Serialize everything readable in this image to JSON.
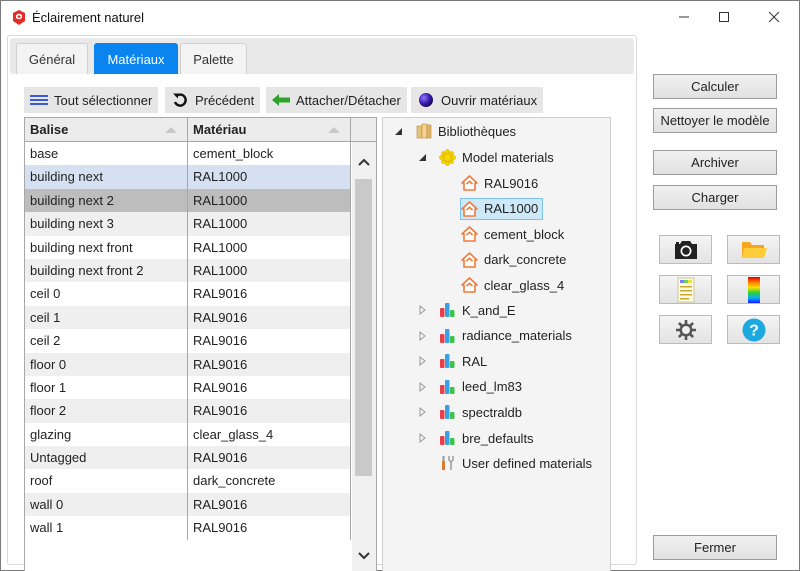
{
  "window": {
    "title": "Éclairement naturel",
    "app_icon": "sketchup-icon",
    "controls": [
      "minimize",
      "maximize",
      "close"
    ]
  },
  "tabs": [
    {
      "label": "Général",
      "active": false
    },
    {
      "label": "Matériaux",
      "active": true
    },
    {
      "label": "Palette",
      "active": false
    }
  ],
  "toolbar": {
    "select_all": {
      "label": "Tout sélectionner",
      "icon": "list-icon"
    },
    "previous": {
      "label": "Précédent",
      "icon": "undo-icon"
    },
    "attach": {
      "label": "Attacher/Détacher",
      "icon": "arrow-left-icon"
    },
    "open_materials": {
      "label": "Ouvrir matériaux",
      "icon": "sphere-icon"
    }
  },
  "grid": {
    "columns": [
      "Balise",
      "Matériau"
    ],
    "rows": [
      {
        "balise": "base",
        "materiau": "cement_block",
        "state": ""
      },
      {
        "balise": "building next",
        "materiau": "RAL1000",
        "state": "hover"
      },
      {
        "balise": "building next 2",
        "materiau": "RAL1000",
        "state": "selected"
      },
      {
        "balise": "building next 3",
        "materiau": "RAL1000",
        "state": ""
      },
      {
        "balise": "building next front",
        "materiau": "RAL1000",
        "state": ""
      },
      {
        "balise": "building next front 2",
        "materiau": "RAL1000",
        "state": ""
      },
      {
        "balise": "ceil 0",
        "materiau": "RAL9016",
        "state": ""
      },
      {
        "balise": "ceil 1",
        "materiau": "RAL9016",
        "state": ""
      },
      {
        "balise": "ceil 2",
        "materiau": "RAL9016",
        "state": ""
      },
      {
        "balise": "floor 0",
        "materiau": "RAL9016",
        "state": ""
      },
      {
        "balise": "floor 1",
        "materiau": "RAL9016",
        "state": ""
      },
      {
        "balise": "floor 2",
        "materiau": "RAL9016",
        "state": ""
      },
      {
        "balise": "glazing",
        "materiau": "clear_glass_4",
        "state": ""
      },
      {
        "balise": "Untagged",
        "materiau": "RAL9016",
        "state": ""
      },
      {
        "balise": "roof",
        "materiau": "dark_concrete",
        "state": ""
      },
      {
        "balise": "wall 0",
        "materiau": "RAL9016",
        "state": ""
      },
      {
        "balise": "wall 1",
        "materiau": "RAL9016",
        "state": ""
      }
    ]
  },
  "tree": {
    "root": {
      "label": "Bibliothèques",
      "expanded": true,
      "icon": "books-icon"
    },
    "model_materials": {
      "label": "Model materials",
      "expanded": true,
      "icon": "sun-icon"
    },
    "model_items": [
      {
        "label": "RAL9016",
        "selected": false
      },
      {
        "label": "RAL1000",
        "selected": true
      },
      {
        "label": "cement_block",
        "selected": false
      },
      {
        "label": "dark_concrete",
        "selected": false
      },
      {
        "label": "clear_glass_4",
        "selected": false
      }
    ],
    "libraries": [
      {
        "label": "K_and_E"
      },
      {
        "label": "radiance_materials"
      },
      {
        "label": "RAL"
      },
      {
        "label": "leed_lm83"
      },
      {
        "label": "spectraldb"
      },
      {
        "label": "bre_defaults"
      }
    ],
    "user_defined": {
      "label": "User defined materials",
      "icon": "tools-icon"
    }
  },
  "actions": {
    "calculer": "Calculer",
    "nettoyer": "Nettoyer le modèle",
    "archiver": "Archiver",
    "charger": "Charger",
    "fermer": "Fermer"
  },
  "icon_buttons": [
    "camera-icon",
    "folder-icon",
    "report-icon",
    "color-scale-icon",
    "settings-icon",
    "help-icon"
  ],
  "colors": {
    "accent": "#0a84ef",
    "row_hover": "#d5e1f2",
    "row_selected": "#bdbdbd",
    "tree_selected": "#cde8f7"
  }
}
